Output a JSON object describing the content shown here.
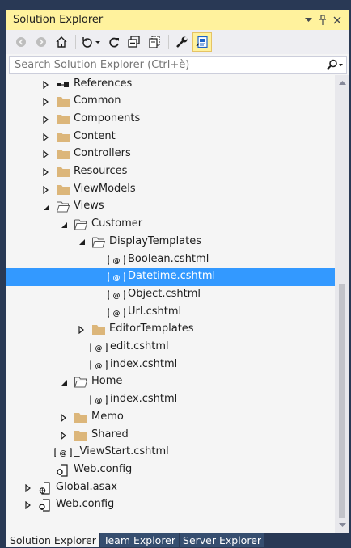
{
  "panel": {
    "title": "Solution Explorer",
    "controls": [
      "dropdown-arrow-icon",
      "pin-icon",
      "close-icon"
    ]
  },
  "toolbar": {
    "buttons": [
      "back-icon",
      "forward-icon",
      "home-icon",
      "history-icon",
      "refresh-icon",
      "collapse-all-icon",
      "show-all-files-icon",
      "properties-icon",
      "preview-icon"
    ]
  },
  "search": {
    "placeholder": "Search Solution Explorer (Ctrl+è)"
  },
  "tree": {
    "items": [
      {
        "label": "References",
        "icon": "references-icon",
        "expander": "collapsed",
        "selected": false
      },
      {
        "label": "Common",
        "icon": "folder-icon",
        "expander": "collapsed",
        "selected": false
      },
      {
        "label": "Components",
        "icon": "folder-icon",
        "expander": "collapsed",
        "selected": false
      },
      {
        "label": "Content",
        "icon": "folder-icon",
        "expander": "collapsed",
        "selected": false
      },
      {
        "label": "Controllers",
        "icon": "folder-icon",
        "expander": "collapsed",
        "selected": false
      },
      {
        "label": "Resources",
        "icon": "folder-icon",
        "expander": "collapsed",
        "selected": false
      },
      {
        "label": "ViewModels",
        "icon": "folder-icon",
        "expander": "collapsed",
        "selected": false
      },
      {
        "label": "Views",
        "icon": "open-folder-icon",
        "expander": "expanded",
        "selected": false
      },
      {
        "label": "Customer",
        "icon": "open-folder-icon",
        "expander": "expanded",
        "selected": false
      },
      {
        "label": "DisplayTemplates",
        "icon": "open-folder-icon",
        "expander": "expanded",
        "selected": false
      },
      {
        "label": "Boolean.cshtml",
        "icon": "razor-file-icon",
        "expander": "none",
        "selected": false
      },
      {
        "label": "Datetime.cshtml",
        "icon": "razor-file-icon",
        "expander": "none",
        "selected": true
      },
      {
        "label": "Object.cshtml",
        "icon": "razor-file-icon",
        "expander": "none",
        "selected": false
      },
      {
        "label": "Url.cshtml",
        "icon": "razor-file-icon",
        "expander": "none",
        "selected": false
      },
      {
        "label": "EditorTemplates",
        "icon": "folder-icon",
        "expander": "collapsed",
        "selected": false
      },
      {
        "label": "edit.cshtml",
        "icon": "razor-file-icon",
        "expander": "none",
        "selected": false
      },
      {
        "label": "index.cshtml",
        "icon": "razor-file-icon",
        "expander": "none",
        "selected": false
      },
      {
        "label": "Home",
        "icon": "open-folder-icon",
        "expander": "expanded",
        "selected": false
      },
      {
        "label": "index.cshtml",
        "icon": "razor-file-icon",
        "expander": "none",
        "selected": false
      },
      {
        "label": "Memo",
        "icon": "folder-icon",
        "expander": "collapsed",
        "selected": false
      },
      {
        "label": "Shared",
        "icon": "folder-icon",
        "expander": "collapsed",
        "selected": false
      },
      {
        "label": "_ViewStart.cshtml",
        "icon": "razor-file-icon",
        "expander": "none",
        "selected": false
      },
      {
        "label": "Web.config",
        "icon": "config-file-icon",
        "expander": "none",
        "selected": false
      },
      {
        "label": "Global.asax",
        "icon": "global-asax-icon",
        "expander": "collapsed",
        "selected": false
      },
      {
        "label": "Web.config",
        "icon": "config-file-icon",
        "expander": "collapsed",
        "selected": false
      }
    ]
  },
  "tabs": [
    {
      "label": "Solution Explorer",
      "active": true
    },
    {
      "label": "Team Explorer",
      "active": false
    },
    {
      "label": "Server Explorer",
      "active": false
    }
  ],
  "colors": {
    "frame": "#293955",
    "title_bar": "#fff29d",
    "selection": "#3399ff",
    "folder": "#dcb67a",
    "background": "#f5f5f5"
  }
}
